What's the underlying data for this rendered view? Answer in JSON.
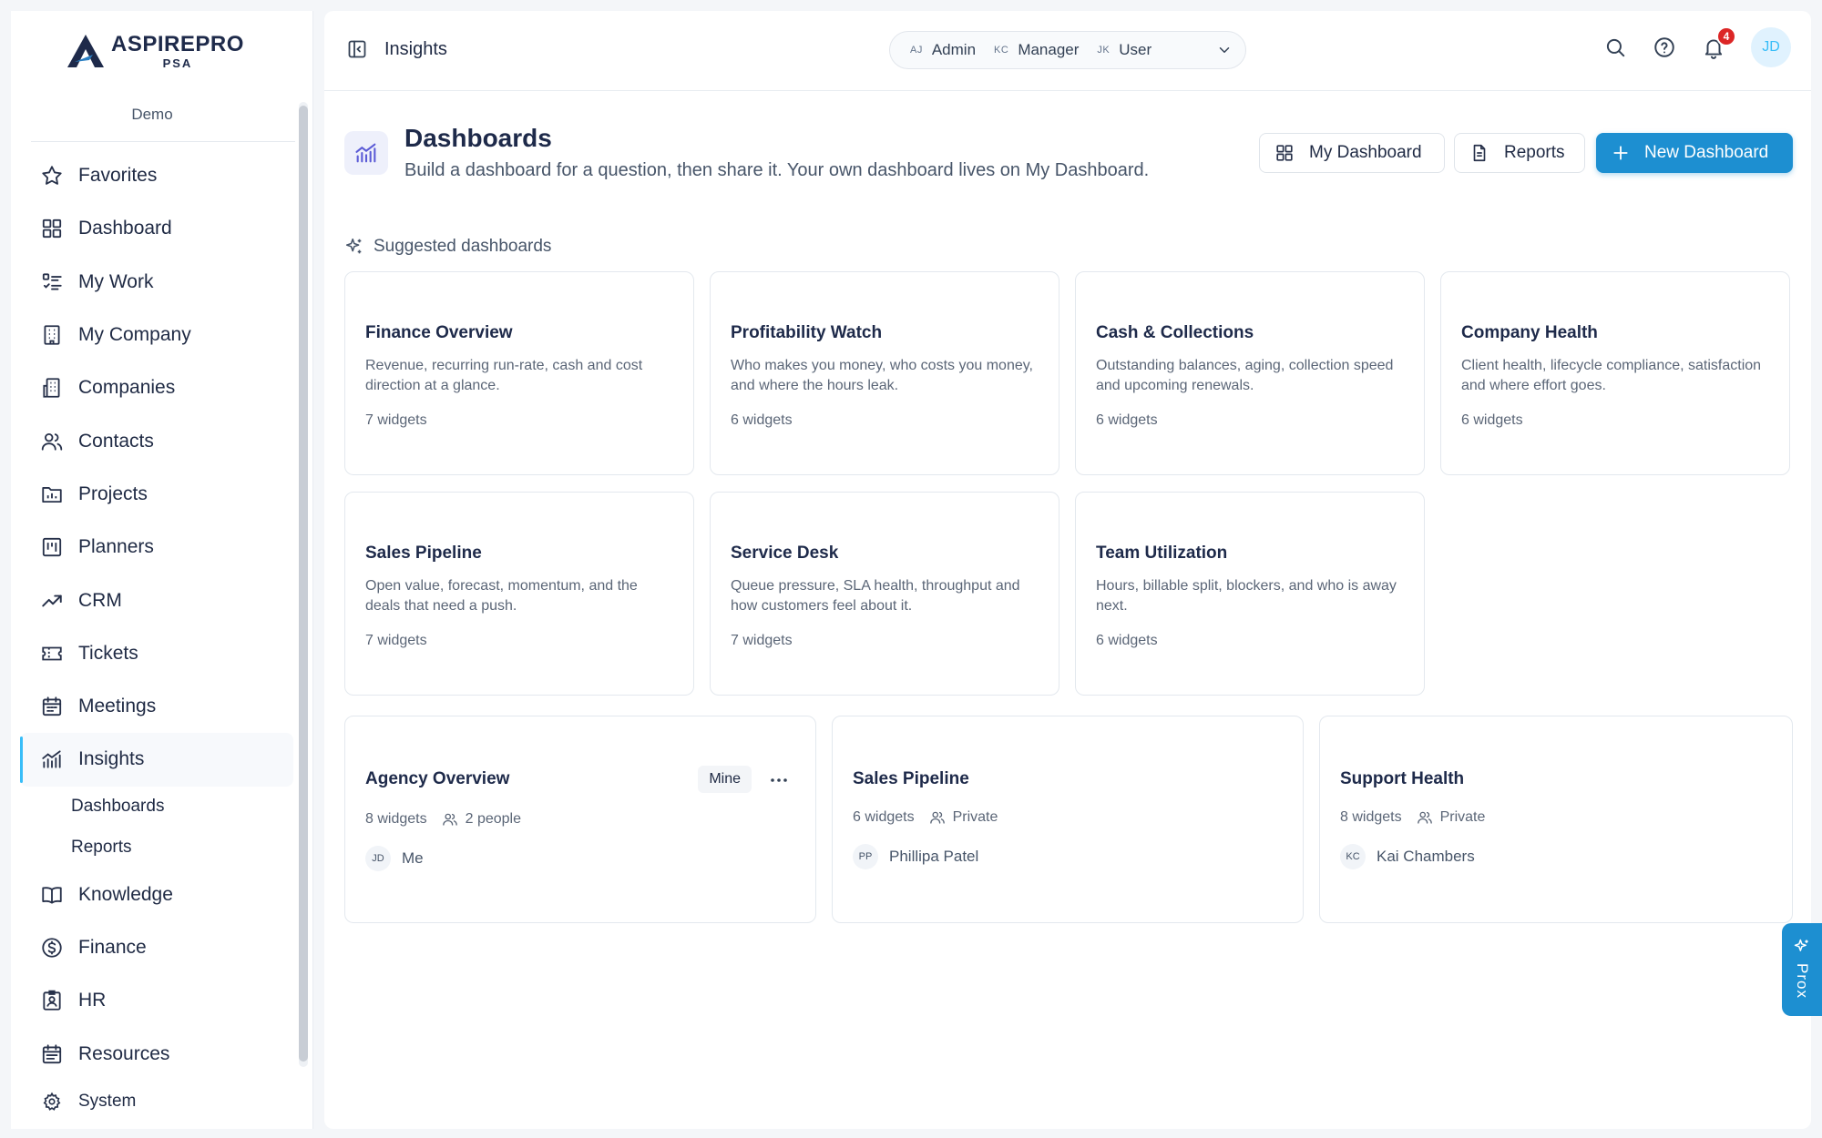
{
  "brand": {
    "name": "ASPIREPRO",
    "sub": "PSA",
    "workspace": "Demo"
  },
  "sidebar": {
    "items": [
      {
        "label": "Favorites",
        "icon": "star-icon"
      },
      {
        "label": "Dashboard",
        "icon": "grid-icon"
      },
      {
        "label": "My Work",
        "icon": "checklist-icon"
      },
      {
        "label": "My Company",
        "icon": "building-icon"
      },
      {
        "label": "Companies",
        "icon": "buildings-icon"
      },
      {
        "label": "Contacts",
        "icon": "users-icon"
      },
      {
        "label": "Projects",
        "icon": "folder-chart-icon"
      },
      {
        "label": "Planners",
        "icon": "kanban-icon"
      },
      {
        "label": "CRM",
        "icon": "trend-up-icon"
      },
      {
        "label": "Tickets",
        "icon": "ticket-icon"
      },
      {
        "label": "Meetings",
        "icon": "calendar-icon"
      },
      {
        "label": "Insights",
        "icon": "bar-chart-icon"
      },
      {
        "label": "Knowledge",
        "icon": "book-icon"
      },
      {
        "label": "Finance",
        "icon": "dollar-circle-icon"
      },
      {
        "label": "HR",
        "icon": "id-badge-icon"
      },
      {
        "label": "Resources",
        "icon": "calendar-list-icon"
      },
      {
        "label": "System",
        "icon": "gear-icon"
      }
    ],
    "sub_items": [
      "Dashboards",
      "Reports"
    ]
  },
  "topbar": {
    "title": "Insights",
    "roles": [
      {
        "initials": "AJ",
        "label": "Admin"
      },
      {
        "initials": "KC",
        "label": "Manager"
      },
      {
        "initials": "JK",
        "label": "User"
      }
    ],
    "notification_count": "4",
    "avatar": "JD"
  },
  "page": {
    "title": "Dashboards",
    "subtitle": "Build a dashboard for a question, then share it. Your own dashboard lives on My Dashboard.",
    "buttons": {
      "my_dashboard": "My Dashboard",
      "reports": "Reports",
      "new_dashboard": "New Dashboard"
    },
    "suggested_label": "Suggested dashboards"
  },
  "suggested": [
    {
      "title": "Finance Overview",
      "desc": "Revenue, recurring run-rate, cash and cost direction at a glance.",
      "count": "7 widgets"
    },
    {
      "title": "Profitability Watch",
      "desc": "Who makes you money, who costs you money, and where the hours leak.",
      "count": "6 widgets"
    },
    {
      "title": "Cash & Collections",
      "desc": "Outstanding balances, aging, collection speed and upcoming renewals.",
      "count": "6 widgets"
    },
    {
      "title": "Company Health",
      "desc": "Client health, lifecycle compliance, satisfaction and where effort goes.",
      "count": "6 widgets"
    },
    {
      "title": "Sales Pipeline",
      "desc": "Open value, forecast, momentum, and the deals that need a push.",
      "count": "7 widgets"
    },
    {
      "title": "Service Desk",
      "desc": "Queue pressure, SLA health, throughput and how customers feel about it.",
      "count": "7 widgets"
    },
    {
      "title": "Team Utilization",
      "desc": "Hours, billable split, blockers, and who is away next.",
      "count": "6 widgets"
    }
  ],
  "dashboards": [
    {
      "title": "Agency Overview",
      "widgets": "8 widgets",
      "sharing": "2 people",
      "owner_initials": "JD",
      "owner": "Me",
      "badge": "Mine"
    },
    {
      "title": "Sales Pipeline",
      "widgets": "6 widgets",
      "sharing": "Private",
      "owner_initials": "PP",
      "owner": "Phillipa Patel"
    },
    {
      "title": "Support Health",
      "widgets": "8 widgets",
      "sharing": "Private",
      "owner_initials": "KC",
      "owner": "Kai Chambers"
    }
  ],
  "assistant": {
    "label": "Prox"
  },
  "colors": {
    "accent": "#1d8fd1",
    "active_indicator": "#38bdf8",
    "badge": "#dc2626",
    "text": "#1f2a44"
  }
}
